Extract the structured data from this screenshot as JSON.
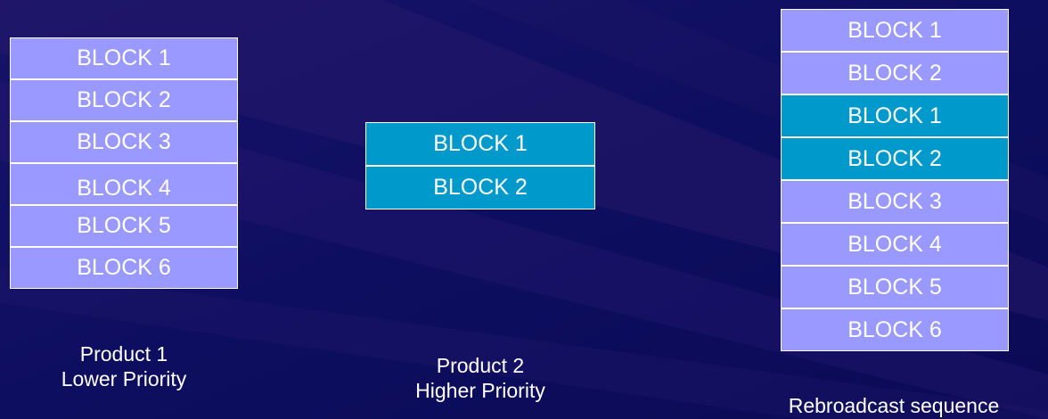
{
  "colors": {
    "background": "#0d0d5e",
    "lower_priority_block": "#9999ff",
    "higher_priority_block": "#0099cc",
    "border": "#ffffff",
    "text": "#ffffff"
  },
  "product_1": {
    "blocks": [
      "BLOCK 1",
      "BLOCK 2",
      "BLOCK 3",
      "BLOCK 4",
      "BLOCK 5",
      "BLOCK 6"
    ],
    "caption_line1": "Product 1",
    "caption_line2": "Lower Priority"
  },
  "product_2": {
    "blocks": [
      "BLOCK 1",
      "BLOCK 2"
    ],
    "caption_line1": "Product 2",
    "caption_line2": "Higher Priority"
  },
  "rebroadcast": {
    "blocks": [
      "BLOCK 1",
      "BLOCK 2",
      "BLOCK 1",
      "BLOCK 2",
      "BLOCK 3",
      "BLOCK 4",
      "BLOCK 5",
      "BLOCK 6"
    ],
    "block_sources": [
      "product_1",
      "product_1",
      "product_2",
      "product_2",
      "product_1",
      "product_1",
      "product_1",
      "product_1"
    ],
    "caption": "Rebroadcast sequence"
  }
}
